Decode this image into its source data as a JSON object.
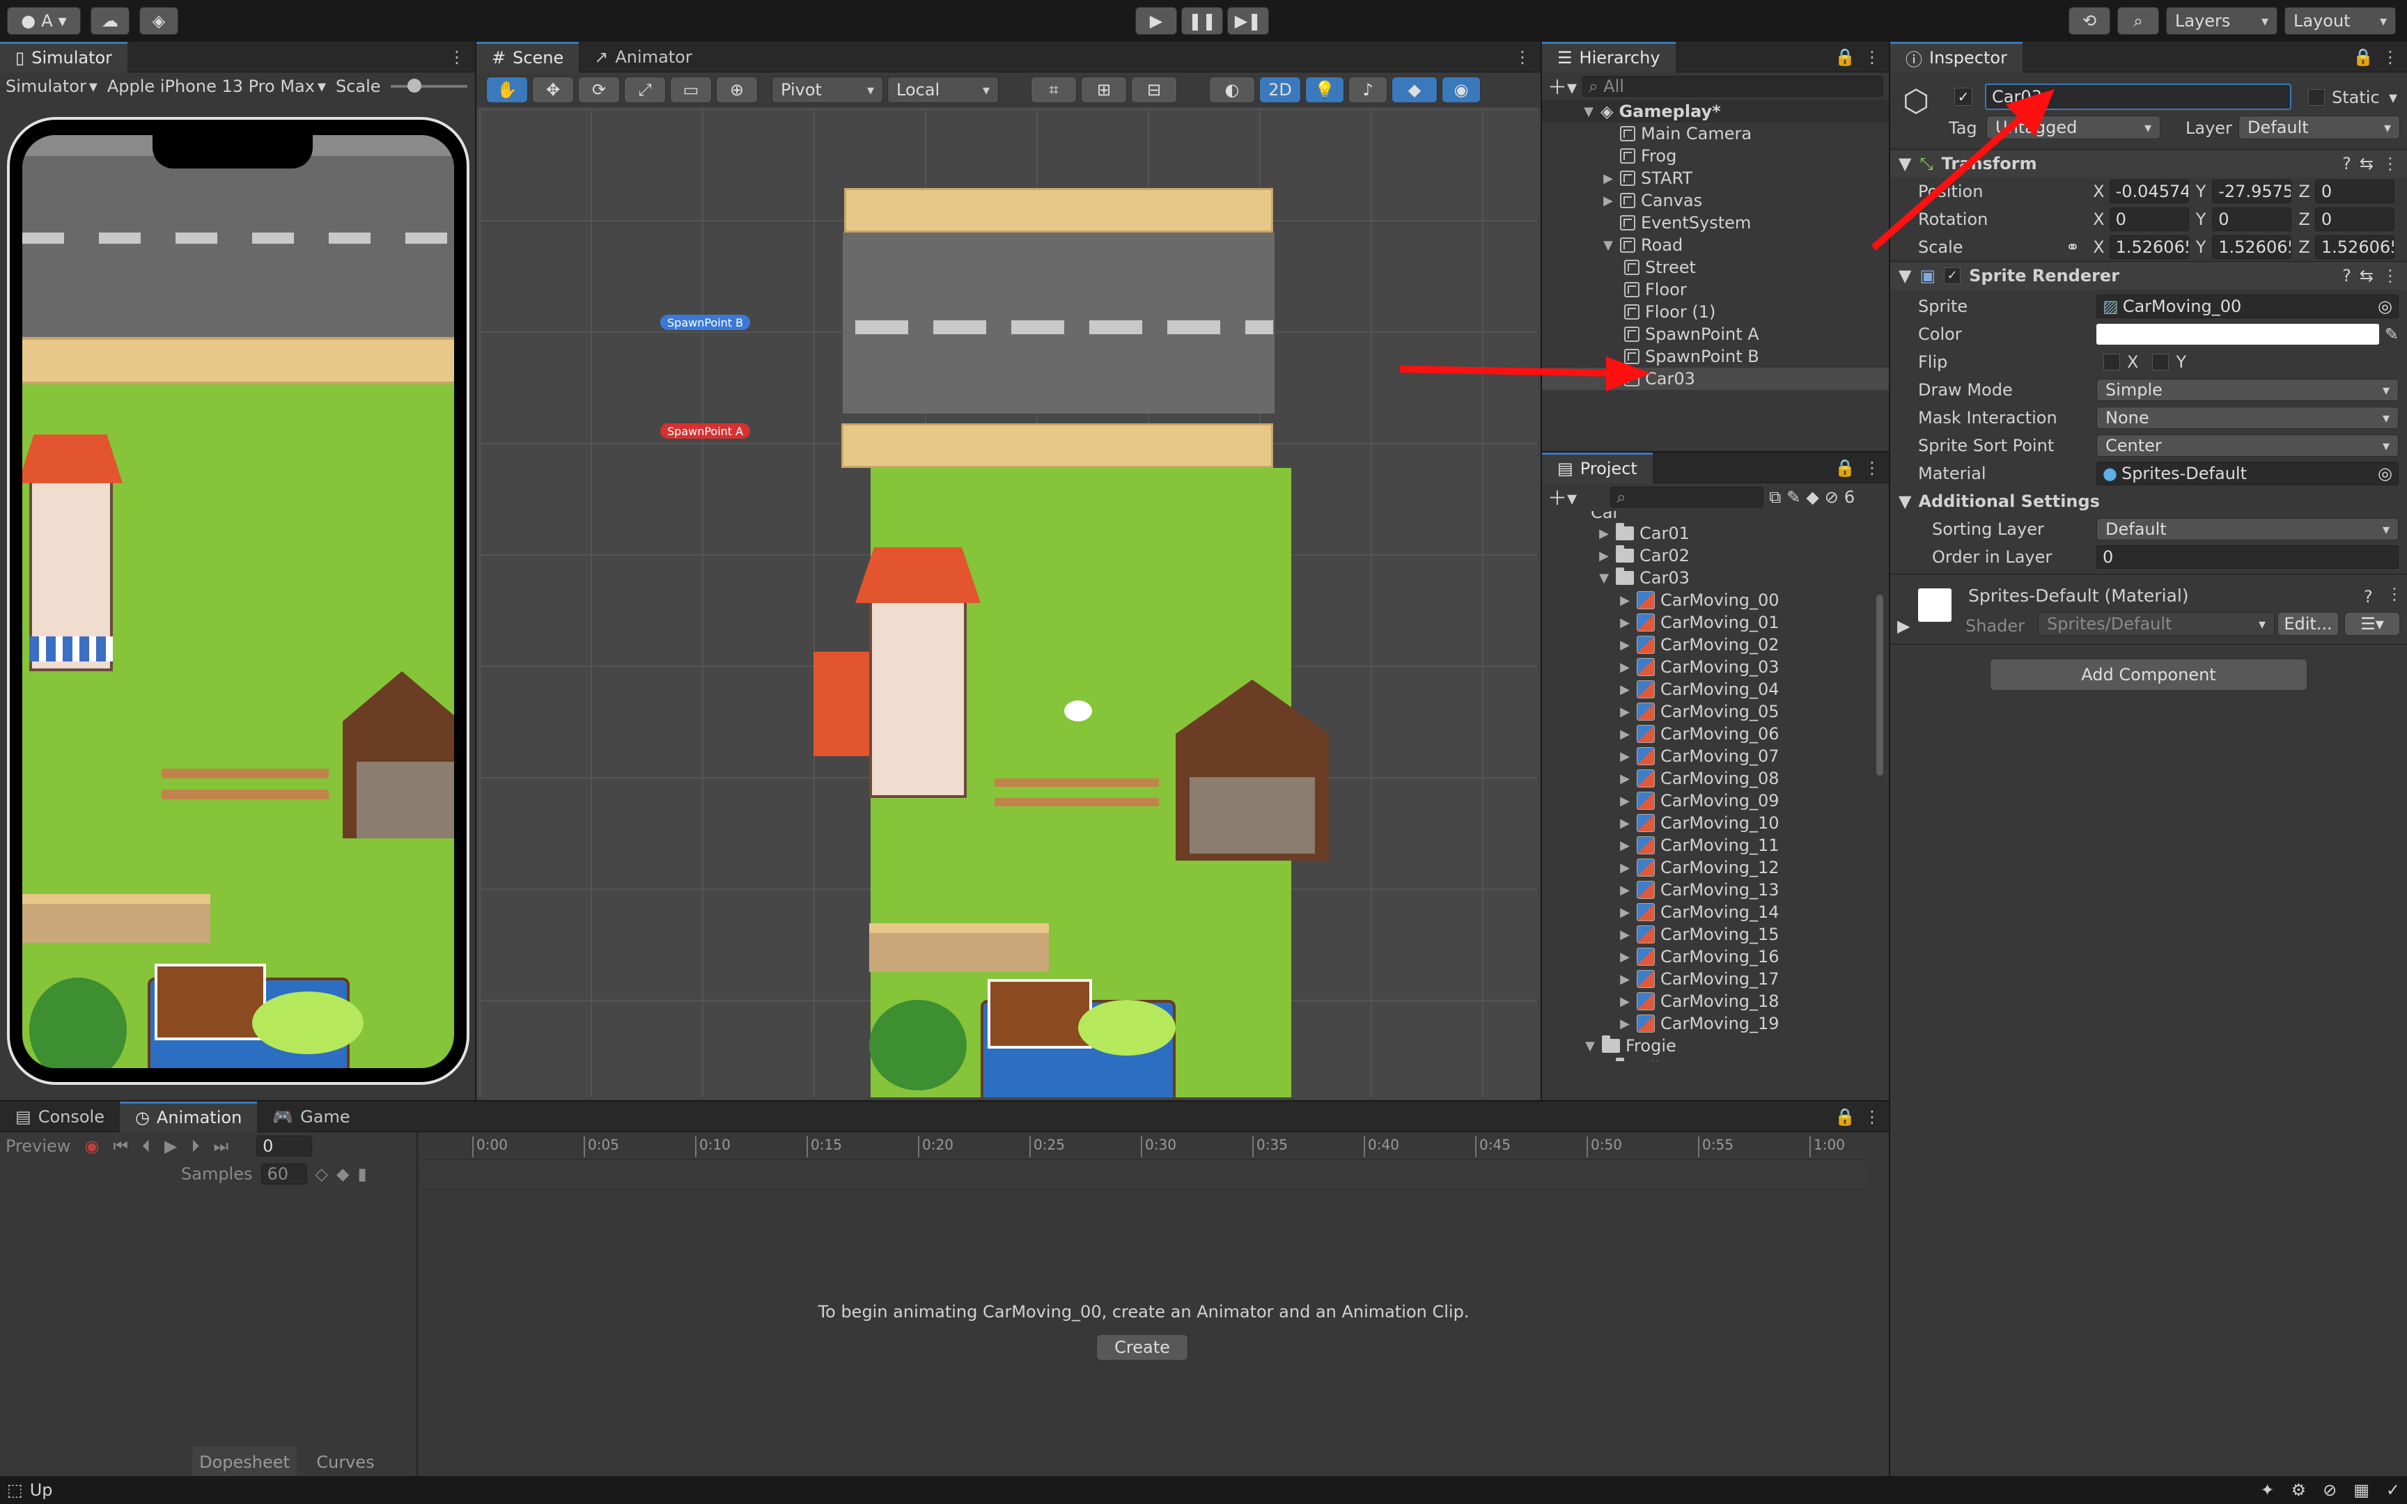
{
  "toolbar": {
    "account_label": "A",
    "layers_label": "Layers",
    "layout_label": "Layout"
  },
  "simulator": {
    "tab_label": "Simulator",
    "mode_label": "Simulator",
    "device_label": "Apple iPhone 13 Pro Max",
    "scale_label": "Scale"
  },
  "scene": {
    "tab_scene": "Scene",
    "tab_animator": "Animator",
    "pivot_label": "Pivot",
    "local_label": "Local",
    "twod_label": "2D",
    "spawn_b": "SpawnPoint B",
    "spawn_a": "SpawnPoint A"
  },
  "hierarchy": {
    "tab_label": "Hierarchy",
    "search_placeholder": "All",
    "root": "Gameplay*",
    "items": [
      "Main Camera",
      "Frog",
      "START",
      "Canvas",
      "EventSystem",
      "Road"
    ],
    "road_children": [
      "Street",
      "Floor",
      "Floor (1)",
      "SpawnPoint A",
      "SpawnPoint B",
      "Car03"
    ]
  },
  "project": {
    "tab_label": "Project",
    "hidden_count": "6",
    "partial_top": "Car",
    "folders": [
      "Car01",
      "Car02",
      "Car03"
    ],
    "sprites": [
      "CarMoving_00",
      "CarMoving_01",
      "CarMoving_02",
      "CarMoving_03",
      "CarMoving_04",
      "CarMoving_05",
      "CarMoving_06",
      "CarMoving_07",
      "CarMoving_08",
      "CarMoving_09",
      "CarMoving_10",
      "CarMoving_11",
      "CarMoving_12",
      "CarMoving_13",
      "CarMoving_14",
      "CarMoving_15",
      "CarMoving_16",
      "CarMoving_17",
      "CarMoving_18",
      "CarMoving_19"
    ],
    "frogie": "Frogie",
    "idle": "Idle"
  },
  "inspector": {
    "tab_label": "Inspector",
    "object_name": "Car03",
    "static_label": "Static",
    "tag_label": "Tag",
    "tag_value": "Untagged",
    "layer_label": "Layer",
    "layer_value": "Default",
    "transform": {
      "title": "Transform",
      "position_label": "Position",
      "rotation_label": "Rotation",
      "scale_label": "Scale",
      "pos": [
        "-0.04574",
        "-27.9575",
        "0"
      ],
      "rot": [
        "0",
        "0",
        "0"
      ],
      "scl": [
        "1.526065",
        "1.526065",
        "1.526065"
      ]
    },
    "sprite_renderer": {
      "title": "Sprite Renderer",
      "sprite_label": "Sprite",
      "sprite_value": "CarMoving_00",
      "color_label": "Color",
      "flip_label": "Flip",
      "drawmode_label": "Draw Mode",
      "drawmode_value": "Simple",
      "mask_label": "Mask Interaction",
      "mask_value": "None",
      "sortpoint_label": "Sprite Sort Point",
      "sortpoint_value": "Center",
      "material_label": "Material",
      "material_value": "Sprites-Default",
      "additional_label": "Additional Settings",
      "sorting_layer_label": "Sorting Layer",
      "sorting_layer_value": "Default",
      "order_label": "Order in Layer",
      "order_value": "0"
    },
    "material": {
      "title": "Sprites-Default (Material)",
      "shader_label": "Shader",
      "shader_value": "Sprites/Default",
      "edit_label": "Edit..."
    },
    "add_component": "Add Component"
  },
  "bottom": {
    "tab_console": "Console",
    "tab_animation": "Animation",
    "tab_game": "Game",
    "preview_label": "Preview",
    "frame_value": "0",
    "samples_label": "Samples",
    "samples_value": "60",
    "ruler": [
      "0:00",
      "0:05",
      "0:10",
      "0:15",
      "0:20",
      "0:25",
      "0:30",
      "0:35",
      "0:40",
      "0:45",
      "0:50",
      "0:55",
      "1:00"
    ],
    "message": "To begin animating CarMoving_00, create an Animator and an Animation Clip.",
    "create_label": "Create",
    "dopesheet_label": "Dopesheet",
    "curves_label": "Curves"
  },
  "status": {
    "text": "Up"
  },
  "colors": {
    "accent": "#3a79bb",
    "grass": "#86c43a",
    "road": "#6a6a6a",
    "annotation": "#ff1010"
  }
}
